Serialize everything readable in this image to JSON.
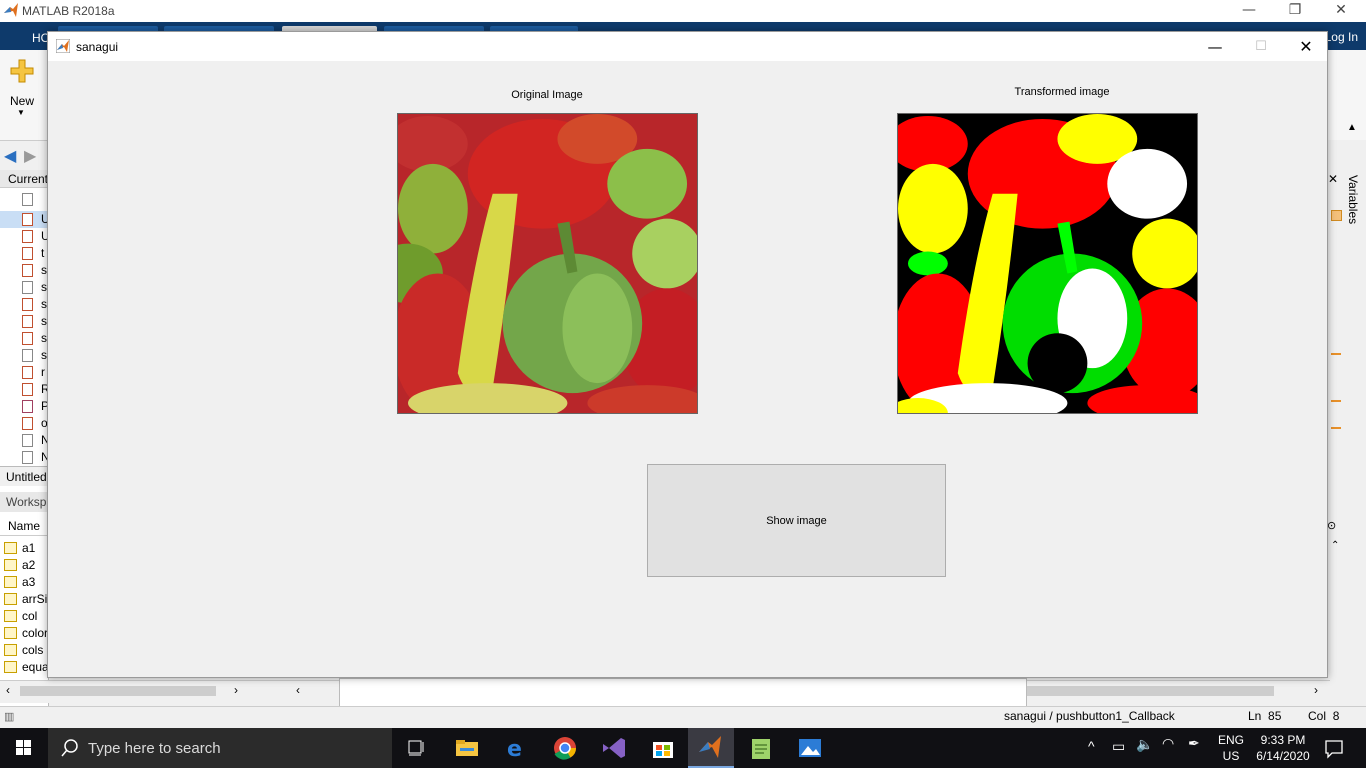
{
  "matlab": {
    "title": "MATLAB R2018a",
    "home_tab": "HO",
    "login": "Log In",
    "new_label": "New",
    "current_folder_header": "Current",
    "current_folder_items": [
      "U",
      "U",
      "t",
      "s",
      "s",
      "s",
      "s",
      "s",
      "s",
      "r",
      "R",
      "P",
      "o",
      "N",
      "N"
    ],
    "untitled": "Untitled",
    "workspace_header": "Worksp",
    "workspace_name_col": "Name ↑",
    "workspace_vars": [
      "a1",
      "a2",
      "a3",
      "arrSi",
      "col",
      "color",
      "cols",
      "equa"
    ],
    "variables_label": "Variables",
    "status_callback": "sanagui / pushbutton1_Callback",
    "status_ln_label": "Ln",
    "status_ln": "85",
    "status_col_label": "Col",
    "status_col": "8"
  },
  "figure": {
    "title": "sanagui",
    "original_label": "Original Image",
    "transformed_label": "Transformed image",
    "button_label": "Show image"
  },
  "taskbar": {
    "search_placeholder": "Type here to search",
    "lang": "ENG",
    "region": "US",
    "time": "9:33 PM",
    "date": "6/14/2020"
  }
}
